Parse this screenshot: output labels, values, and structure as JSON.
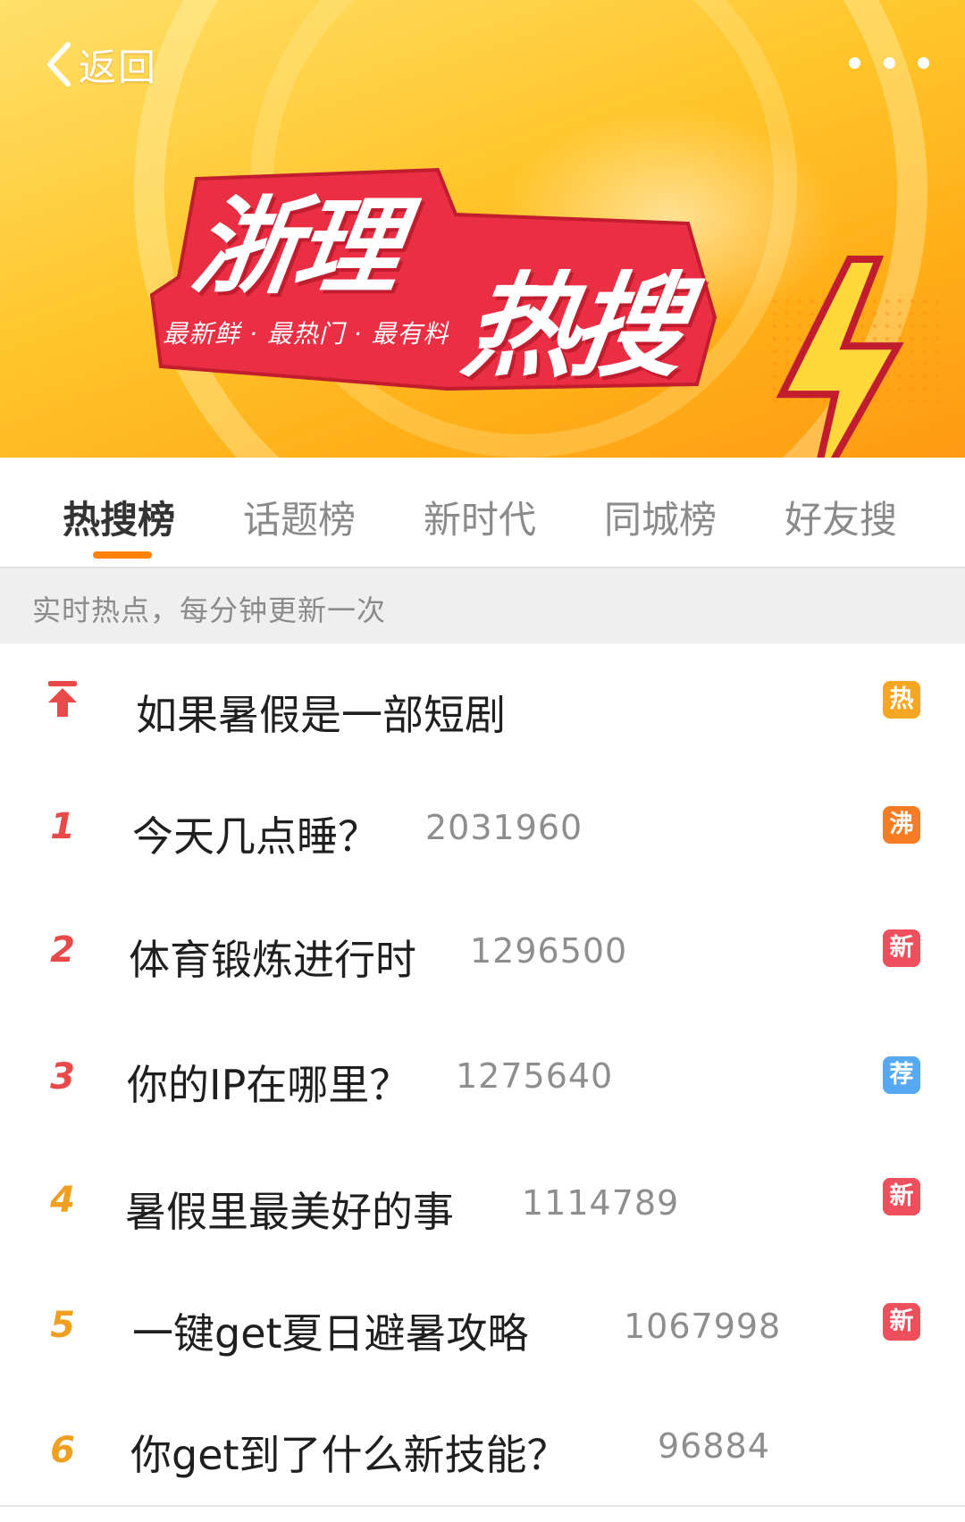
{
  "header": {
    "back_label": "返回",
    "title_part1": "浙理",
    "title_part2": "热搜",
    "slogan": "最新鲜 · 最热门 · 最有料"
  },
  "tabs": [
    {
      "label": "热搜榜",
      "active": true
    },
    {
      "label": "话题榜",
      "active": false
    },
    {
      "label": "新时代",
      "active": false
    },
    {
      "label": "同城榜",
      "active": false
    },
    {
      "label": "好友搜",
      "active": false
    }
  ],
  "notice": "实时热点，每分钟更新一次",
  "items": [
    {
      "rank": "",
      "pinned": true,
      "title": "如果暑假是一部短剧",
      "count": "",
      "badge": "热",
      "badge_color": "#f5a623"
    },
    {
      "rank": "1",
      "title": "今天几点睡？",
      "count": "2031960",
      "badge": "沸",
      "badge_color": "#f57c22"
    },
    {
      "rank": "2",
      "title": "体育锻炼进行时",
      "count": "1296500",
      "badge": "新",
      "badge_color": "#ee4f5c"
    },
    {
      "rank": "3",
      "title": "你的IP在哪里？",
      "count": "1275640",
      "badge": "荐",
      "badge_color": "#56a8f0"
    },
    {
      "rank": "4",
      "title": "暑假里最美好的事",
      "count": "1114789",
      "badge": "新",
      "badge_color": "#ee4f5c"
    },
    {
      "rank": "5",
      "title": "一键get夏日避暑攻略",
      "count": "1067998",
      "badge": "新",
      "badge_color": "#ee4f5c"
    },
    {
      "rank": "6",
      "title": "你get到了什么新技能？",
      "count": "96884",
      "badge": "",
      "badge_color": ""
    }
  ],
  "colors": {
    "accent": "#ff8200",
    "rank_top3": "#e84a4a",
    "rank_other": "#f0a020",
    "pin": "#e84a4a"
  },
  "icons": {
    "back": "chevron-left-icon",
    "more": "more-dots-icon",
    "pin": "pin-top-icon",
    "bolt": "lightning-icon"
  }
}
